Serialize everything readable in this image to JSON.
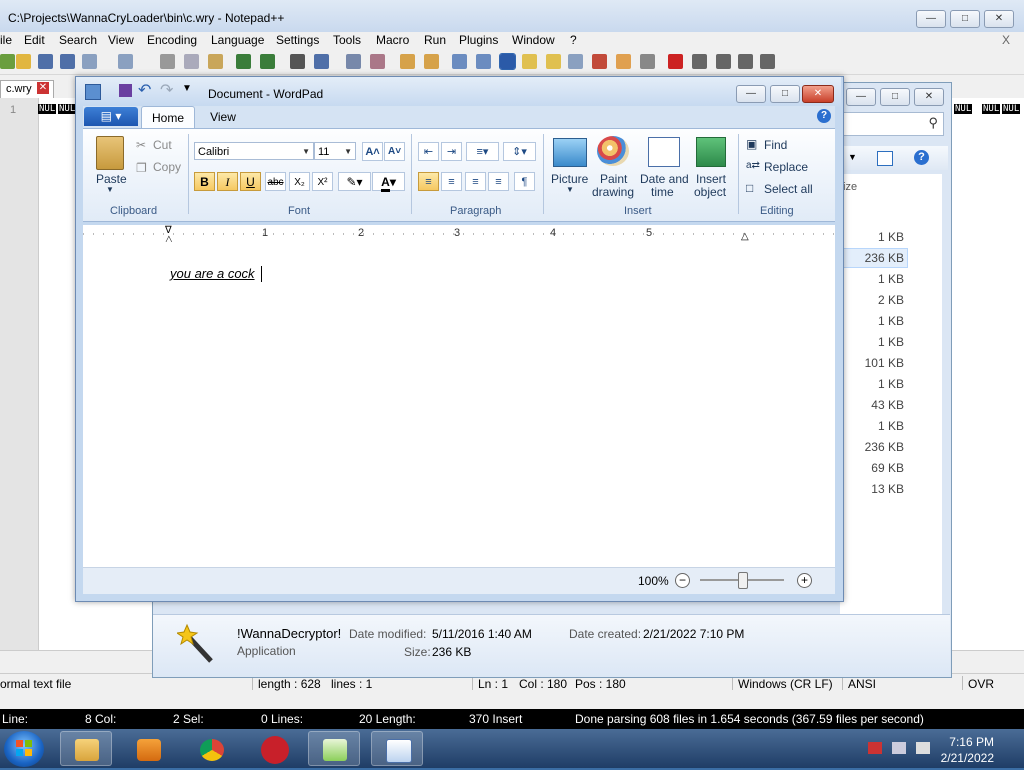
{
  "notepadpp": {
    "title": "C:\\Projects\\WannaCryLoader\\bin\\c.wry - Notepad++",
    "menu": [
      "ile",
      "Edit",
      "Search",
      "View",
      "Encoding",
      "Language",
      "Settings",
      "Tools",
      "Macro",
      "Run",
      "Plugins",
      "Window",
      "?"
    ],
    "menu_close": "X",
    "tab_label": "c.wry",
    "line_number": "1",
    "nul_token": "NUL",
    "status": {
      "file_type": "ormal text file",
      "length": "length : 628",
      "lines": "lines : 1",
      "ln": "Ln : 1",
      "col": "Col : 180",
      "pos": "Pos : 180",
      "eol": "Windows (CR LF)",
      "encoding": "ANSI",
      "mode": "OVR"
    },
    "search_status": {
      "line": "Line:",
      "col": "8 Col:",
      "sel": "2 Sel:",
      "lines": "0 Lines:",
      "length": "20 Length:",
      "insert": "370 Insert",
      "message": "Done parsing 608 files in 1.654 seconds (367.59 files per second)"
    }
  },
  "explorer": {
    "size_header": "ize",
    "sizes": [
      "1 KB",
      "236 KB",
      "1 KB",
      "2 KB",
      "1 KB",
      "1 KB",
      "101 KB",
      "1 KB",
      "43 KB",
      "1 KB",
      "236 KB",
      "69 KB",
      "13 KB"
    ],
    "details": {
      "name": "!WannaDecryptor!",
      "type": "Application",
      "date_modified_label": "Date modified:",
      "date_modified": "5/11/2016 1:40 AM",
      "date_created_label": "Date created:",
      "date_created": "2/21/2022 7:10 PM",
      "size_label": "Size:",
      "size": "236 KB"
    }
  },
  "wordpad": {
    "title": "Document - WordPad",
    "tabs": {
      "home": "Home",
      "view": "View"
    },
    "clipboard": {
      "paste": "Paste",
      "cut": "Cut",
      "copy": "Copy",
      "group": "Clipboard"
    },
    "font": {
      "family": "Calibri",
      "size": "11",
      "group": "Font",
      "bold": "B",
      "italic": "I",
      "underline": "U",
      "strike": "abc",
      "sub": "X₂",
      "sup": "X²"
    },
    "paragraph": {
      "group": "Paragraph"
    },
    "insert": {
      "picture": "Picture",
      "paint1": "Paint",
      "paint2": "drawing",
      "date1": "Date and",
      "date2": "time",
      "obj1": "Insert",
      "obj2": "object",
      "group": "Insert"
    },
    "editing": {
      "find": "Find",
      "replace": "Replace",
      "select_all": "Select all",
      "group": "Editing"
    },
    "ruler": [
      "1",
      "2",
      "3",
      "4",
      "5"
    ],
    "document_text": "you are a cock",
    "zoom": "100%"
  },
  "taskbar": {
    "time": "7:16 PM",
    "date": "2/21/2022"
  },
  "colors": {
    "ribbon_accent": "#1d56b0",
    "highlight": "#f6c861"
  }
}
